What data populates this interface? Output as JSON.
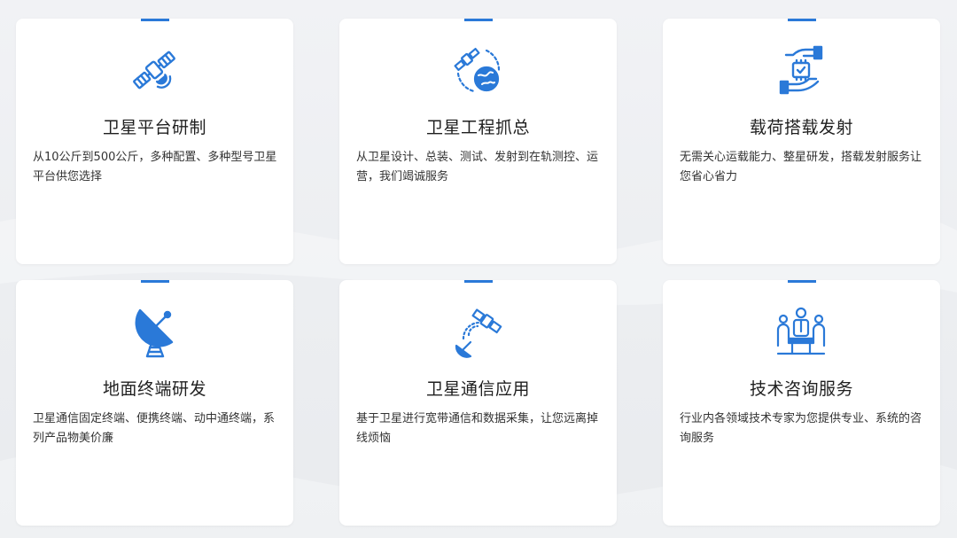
{
  "theme": {
    "accent": "#2a79d8",
    "card_background": "#ffffff",
    "page_background": "#eef0f3",
    "title_color": "#1f1f1f",
    "text_color": "#333333"
  },
  "cards": [
    {
      "icon": "satellite-icon",
      "title": "卫星平台研制",
      "description": "从10公斤到500公斤，多种配置、多种型号卫星平台供您选择"
    },
    {
      "icon": "satellite-earth-orbit-icon",
      "title": "卫星工程抓总",
      "description": "从卫星设计、总装、测试、发射到在轨测控、运营，我们竭诚服务"
    },
    {
      "icon": "hands-chip-icon",
      "title": "载荷搭载发射",
      "description": "无需关心运载能力、整星研发，搭载发射服务让您省心省力"
    },
    {
      "icon": "satellite-dish-icon",
      "title": "地面终端研发",
      "description": "卫星通信固定终端、便携终端、动中通终端，系列产品物美价廉"
    },
    {
      "icon": "satellite-signal-icon",
      "title": "卫星通信应用",
      "description": "基于卫星进行宽带通信和数据采集，让您远离掉线烦恼"
    },
    {
      "icon": "consulting-meeting-icon",
      "title": "技术咨询服务",
      "description": "行业内各领域技术专家为您提供专业、系统的咨询服务"
    }
  ]
}
